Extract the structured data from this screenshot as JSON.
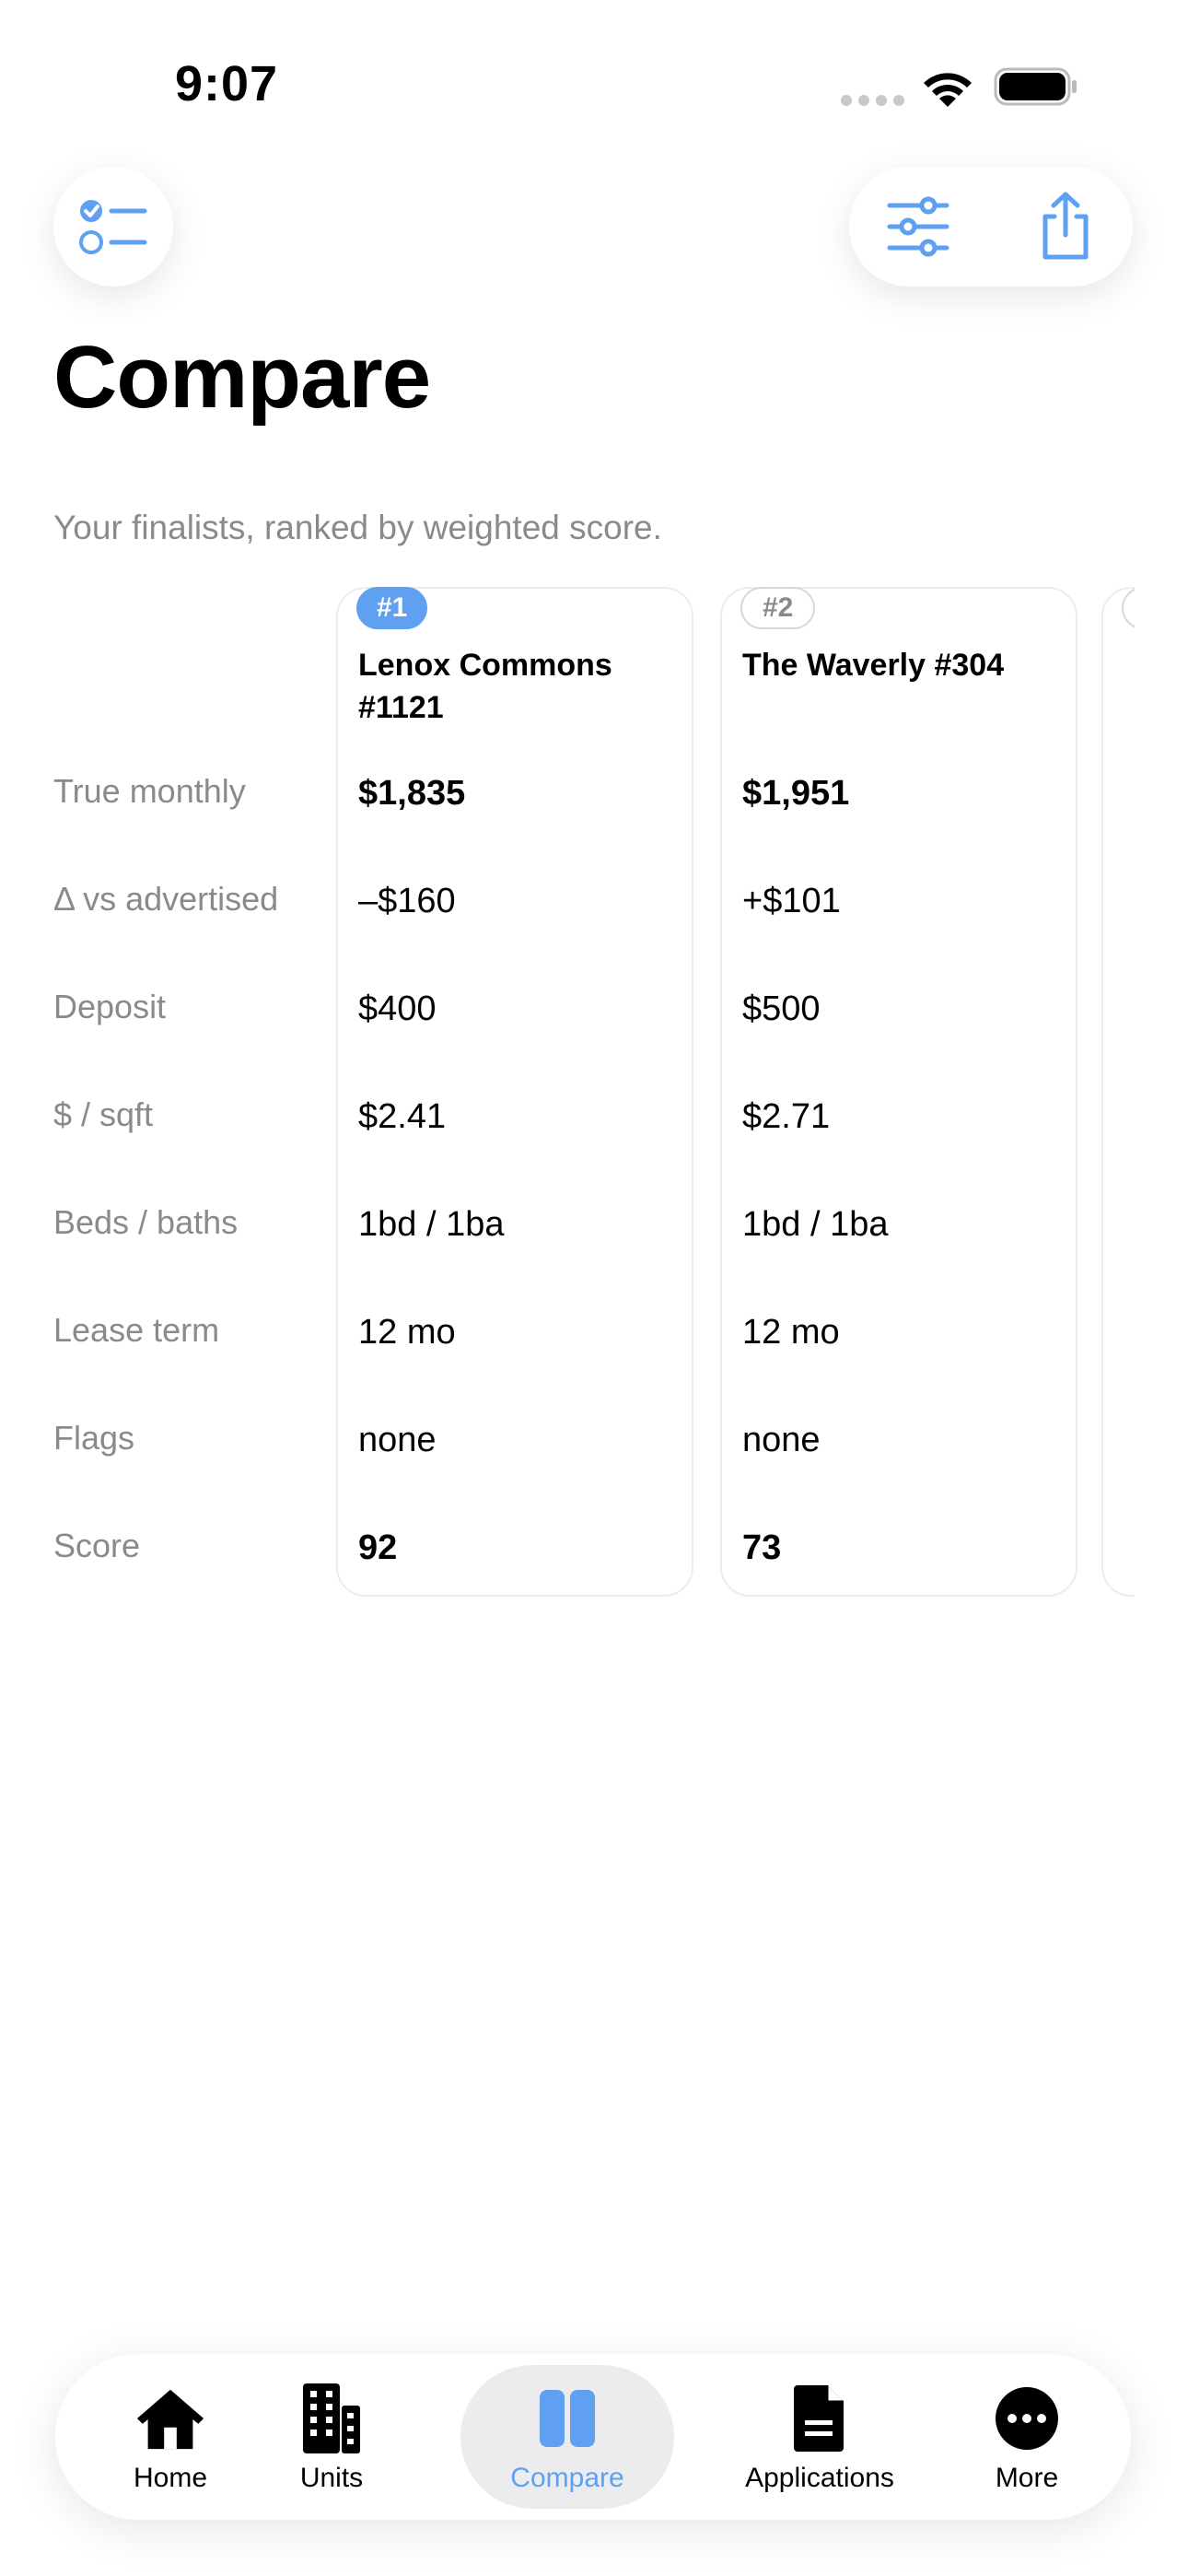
{
  "status": {
    "time": "9:07"
  },
  "page": {
    "title": "Compare",
    "subtitle": "Your finalists, ranked by weighted score."
  },
  "rows": [
    "True monthly",
    "Δ vs advertised",
    "Deposit",
    "$ / sqft",
    "Beds / baths",
    "Lease term",
    "Flags",
    "Score"
  ],
  "cards": [
    {
      "rank": "#1",
      "name": "Lenox Commons #1121",
      "values": [
        "$1,835",
        "–$160",
        "$400",
        "$2.41",
        "1bd / 1ba",
        "12 mo",
        "none",
        "92"
      ]
    },
    {
      "rank": "#2",
      "name": "The Waverly #304",
      "values": [
        "$1,951",
        "+$101",
        "$500",
        "$2.71",
        "1bd / 1ba",
        "12 mo",
        "none",
        "73"
      ]
    }
  ],
  "tabs": [
    {
      "label": "Home",
      "icon": "house-icon"
    },
    {
      "label": "Units",
      "icon": "building-icon"
    },
    {
      "label": "Compare",
      "icon": "compare-columns-icon"
    },
    {
      "label": "Applications",
      "icon": "document-icon"
    },
    {
      "label": "More",
      "icon": "ellipsis-circle-icon"
    }
  ],
  "colors": {
    "accent": "#5fa0f0",
    "muted": "#8a8a8e",
    "border": "#ececee"
  }
}
